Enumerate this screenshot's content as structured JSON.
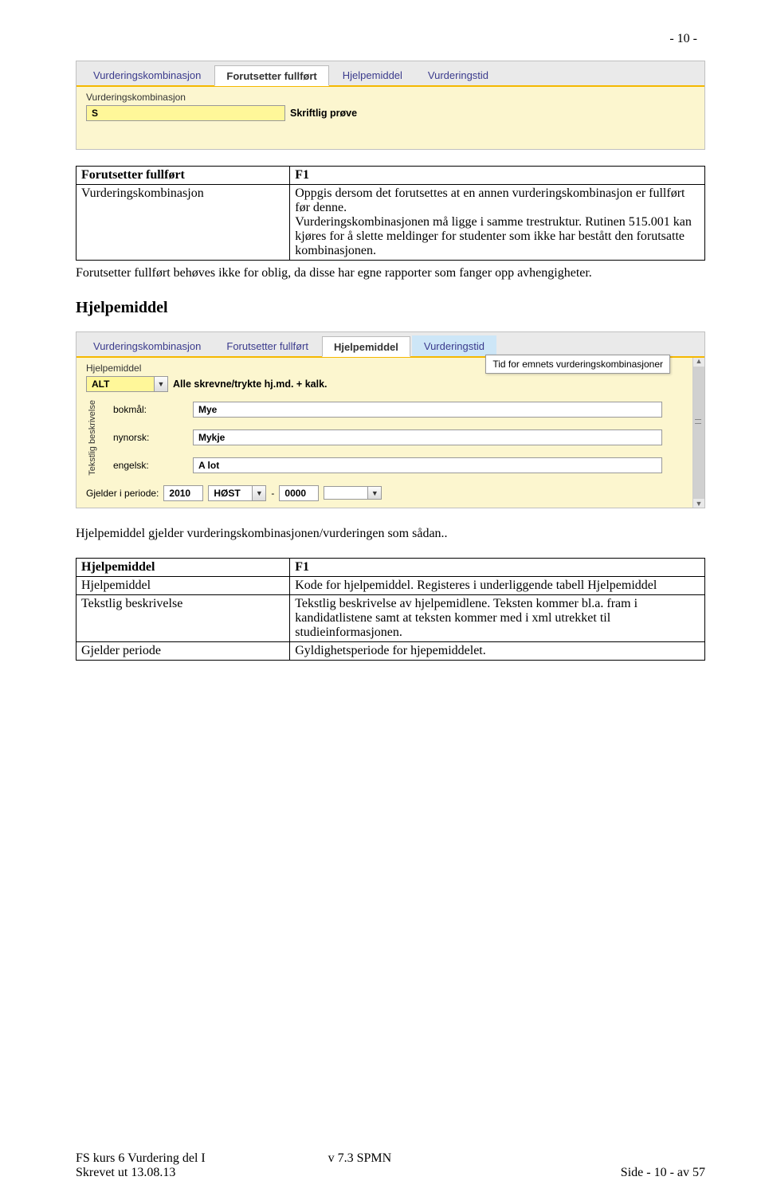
{
  "pageTop": "- 10 -",
  "shot1": {
    "tabs": [
      "Vurderingskombinasjon",
      "Forutsetter fullført",
      "Hjelpemiddel",
      "Vurderingstid"
    ],
    "activeIndex": 1,
    "label": "Vurderingskombinasjon",
    "codeValue": "S",
    "descValue": "Skriftlig prøve"
  },
  "table1": {
    "r1c1": "Forutsetter fullført",
    "r1c2": "F1",
    "r2c1": "Vurderingskombinasjon",
    "r2c2": "Oppgis dersom det forutsettes at en annen vurderingskombinasjon er fullført før denne. \nVurderingskombinasjonen må ligge i samme trestruktur. Rutinen 515.001 kan kjøres for å slette meldinger for studenter som ikke har bestått den forutsatte kombinasjonen."
  },
  "para1": "Forutsetter fullført behøves ikke for oblig, da disse har egne rapporter som fanger opp avhengigheter.",
  "sectionTitle": "Hjelpemiddel",
  "shot2": {
    "tabs": [
      "Vurderingskombinasjon",
      "Forutsetter fullført",
      "Hjelpemiddel",
      "Vurderingstid"
    ],
    "activeIndex": 2,
    "hoverIndex": 3,
    "tooltip": "Tid for emnets vurderingskombinasjoner",
    "label": "Hjelpemiddel",
    "codeValue": "ALT",
    "descValue": "Alle skrevne/trykte hj.md. + kalk.",
    "verticalLabel": "Tekstlig beskrivelse",
    "rows": [
      {
        "lang": "bokmål:",
        "val": "Mye"
      },
      {
        "lang": "nynorsk:",
        "val": "Mykje"
      },
      {
        "lang": "engelsk:",
        "val": "A lot"
      }
    ],
    "periodLabel": "Gjelder i periode:",
    "year1": "2010",
    "term1": "HØST",
    "dash": "-",
    "year2": "0000"
  },
  "para2": "Hjelpemiddel gjelder vurderingskombinasjonen/vurderingen som sådan..",
  "table2": {
    "r1c1": "Hjelpemiddel",
    "r1c2": "F1",
    "r2c1": "Hjelpemiddel",
    "r2c2": "Kode for hjelpemiddel. Registeres i underliggende tabell Hjelpemiddel",
    "r3c1": "Tekstlig beskrivelse",
    "r3c2": "Tekstlig beskrivelse av hjelpemidlene. Teksten kommer bl.a. fram i kandidatlistene samt at teksten kommer med i xml utrekket til studieinformasjonen.",
    "r4c1": "Gjelder periode",
    "r4c2": "Gyldighetsperiode for hjepemiddelet."
  },
  "footer": {
    "left1": "FS kurs 6 Vurdering del I",
    "left2": "Skrevet ut 13.08.13",
    "mid1": "v 7.3 SPMN",
    "right2": "Side - 10 - av 57"
  }
}
